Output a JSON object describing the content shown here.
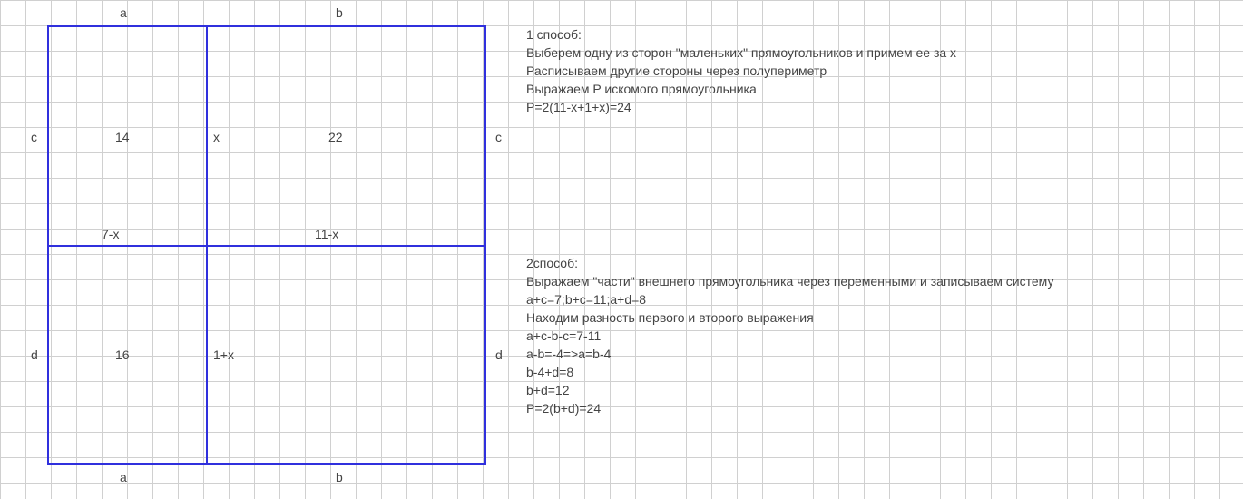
{
  "diagram": {
    "top_labels": {
      "a": "a",
      "b": "b"
    },
    "bottom_labels": {
      "a": "a",
      "b": "b"
    },
    "left_labels": {
      "c": "c",
      "d": "d"
    },
    "right_labels": {
      "c": "c",
      "d": "d"
    },
    "cell_values": {
      "top_left": "14",
      "top_right": "22",
      "bottom_left": "16"
    },
    "inner_labels": {
      "x": "x",
      "seven_minus_x": "7-x",
      "eleven_minus_x": "11-x",
      "one_plus_x": "1+x"
    }
  },
  "method1": {
    "title": "1 способ:",
    "line1": "Выберем одну из сторон \"маленьких\" прямоугольников и примем ее за x",
    "line2": "Расписываем другие стороны через полупериметр",
    "line3": "Выражаем P искомого прямоугольника",
    "line4": "P=2(11-x+1+x)=24"
  },
  "method2": {
    "title": "2способ:",
    "line1": "Выражаем \"части\" внешнего прямоугольника через переменными и записываем систему",
    "line2": "a+c=7;b+c=11;a+d=8",
    "line3": "Находим разность первого и второго выражения",
    "line4": "a+c-b-c=7-11",
    "line5": "a-b=-4=>a=b-4",
    "line6": "b-4+d=8",
    "line7": "b+d=12",
    "line8": "P=2(b+d)=24"
  },
  "chart_data": {
    "type": "diagram",
    "title": "Rectangle perimeter problem",
    "outer_rectangle": {
      "width_segments": [
        "a",
        "b"
      ],
      "height_segments": [
        "c",
        "d"
      ]
    },
    "inner_rectangles": [
      {
        "position": "top-left",
        "perimeter": 14,
        "width": "a",
        "height": "c",
        "alt_width": "7-x"
      },
      {
        "position": "top-right",
        "perimeter": 22,
        "width": "b",
        "height": "c",
        "alt_left_height": "x",
        "alt_width": "11-x"
      },
      {
        "position": "bottom-left",
        "perimeter": 16,
        "width": "a",
        "height": "d"
      },
      {
        "position": "bottom-right",
        "perimeter": null,
        "width": "b",
        "height": "d",
        "alt_left_height": "1+x"
      }
    ],
    "equations": {
      "method1": "P=2(11-x+1+x)=24",
      "method2": [
        "a+c=7",
        "b+c=11",
        "a+d=8",
        "a+c-b-c=7-11",
        "a-b=-4",
        "a=b-4",
        "b-4+d=8",
        "b+d=12",
        "P=2(b+d)=24"
      ]
    },
    "answer": 24
  }
}
